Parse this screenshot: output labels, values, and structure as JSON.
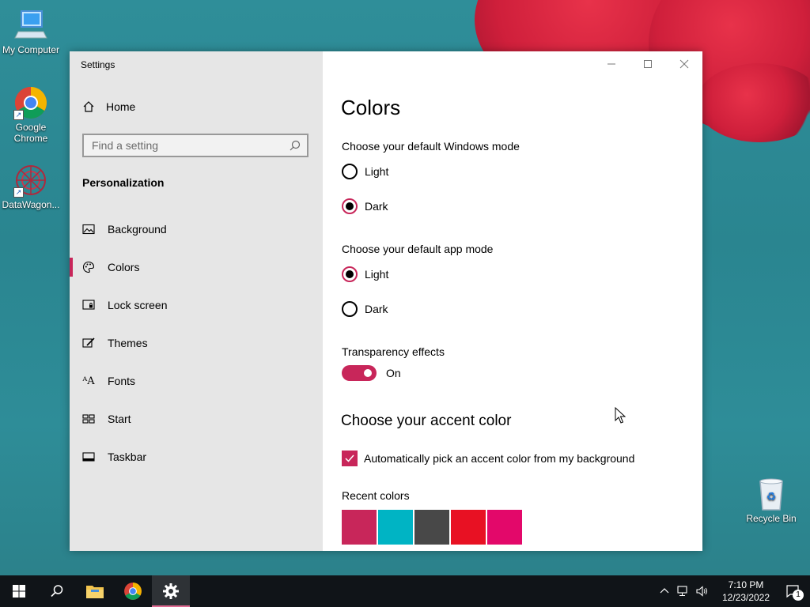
{
  "desktop": {
    "icons": [
      {
        "label": "My Computer"
      },
      {
        "label": "Google Chrome"
      },
      {
        "label": "DataWagon..."
      },
      {
        "label": "Recycle Bin"
      }
    ]
  },
  "window": {
    "title": "Settings",
    "home_label": "Home",
    "search_placeholder": "Find a setting",
    "section_title": "Personalization",
    "nav_items": [
      {
        "label": "Background",
        "icon": "image-icon"
      },
      {
        "label": "Colors",
        "icon": "palette-icon",
        "active": true
      },
      {
        "label": "Lock screen",
        "icon": "lock-screen-icon"
      },
      {
        "label": "Themes",
        "icon": "themes-icon"
      },
      {
        "label": "Fonts",
        "icon": "fonts-icon"
      },
      {
        "label": "Start",
        "icon": "start-icon"
      },
      {
        "label": "Taskbar",
        "icon": "taskbar-icon"
      }
    ]
  },
  "content": {
    "page_title": "Colors",
    "windows_mode": {
      "label": "Choose your default Windows mode",
      "options": [
        "Light",
        "Dark"
      ],
      "selected": "Dark"
    },
    "app_mode": {
      "label": "Choose your default app mode",
      "options": [
        "Light",
        "Dark"
      ],
      "selected": "Light"
    },
    "transparency": {
      "label": "Transparency effects",
      "state_label": "On",
      "on": true
    },
    "accent_title": "Choose your accent color",
    "auto_accent_label": "Automatically pick an accent color from my background",
    "auto_accent_checked": true,
    "recent_colors_label": "Recent colors",
    "recent_colors": [
      "#c8265a",
      "#00b4c4",
      "#484848",
      "#e81123",
      "#e3086a"
    ]
  },
  "taskbar": {
    "time": "7:10 PM",
    "date": "12/23/2022",
    "notification_count": "1"
  },
  "colors": {
    "accent": "#c8265a"
  }
}
